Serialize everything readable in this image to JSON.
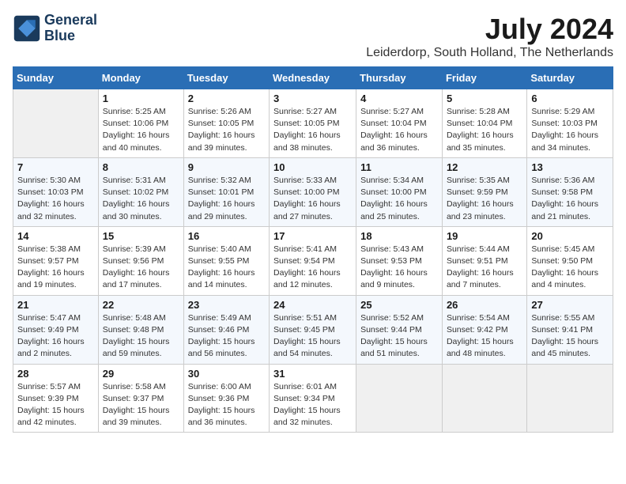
{
  "header": {
    "logo_line1": "General",
    "logo_line2": "Blue",
    "month_year": "July 2024",
    "location": "Leiderdorp, South Holland, The Netherlands"
  },
  "weekdays": [
    "Sunday",
    "Monday",
    "Tuesday",
    "Wednesday",
    "Thursday",
    "Friday",
    "Saturday"
  ],
  "weeks": [
    [
      {
        "day": "",
        "sunrise": "",
        "sunset": "",
        "daylight": ""
      },
      {
        "day": "1",
        "sunrise": "Sunrise: 5:25 AM",
        "sunset": "Sunset: 10:06 PM",
        "daylight": "Daylight: 16 hours and 40 minutes."
      },
      {
        "day": "2",
        "sunrise": "Sunrise: 5:26 AM",
        "sunset": "Sunset: 10:05 PM",
        "daylight": "Daylight: 16 hours and 39 minutes."
      },
      {
        "day": "3",
        "sunrise": "Sunrise: 5:27 AM",
        "sunset": "Sunset: 10:05 PM",
        "daylight": "Daylight: 16 hours and 38 minutes."
      },
      {
        "day": "4",
        "sunrise": "Sunrise: 5:27 AM",
        "sunset": "Sunset: 10:04 PM",
        "daylight": "Daylight: 16 hours and 36 minutes."
      },
      {
        "day": "5",
        "sunrise": "Sunrise: 5:28 AM",
        "sunset": "Sunset: 10:04 PM",
        "daylight": "Daylight: 16 hours and 35 minutes."
      },
      {
        "day": "6",
        "sunrise": "Sunrise: 5:29 AM",
        "sunset": "Sunset: 10:03 PM",
        "daylight": "Daylight: 16 hours and 34 minutes."
      }
    ],
    [
      {
        "day": "7",
        "sunrise": "Sunrise: 5:30 AM",
        "sunset": "Sunset: 10:03 PM",
        "daylight": "Daylight: 16 hours and 32 minutes."
      },
      {
        "day": "8",
        "sunrise": "Sunrise: 5:31 AM",
        "sunset": "Sunset: 10:02 PM",
        "daylight": "Daylight: 16 hours and 30 minutes."
      },
      {
        "day": "9",
        "sunrise": "Sunrise: 5:32 AM",
        "sunset": "Sunset: 10:01 PM",
        "daylight": "Daylight: 16 hours and 29 minutes."
      },
      {
        "day": "10",
        "sunrise": "Sunrise: 5:33 AM",
        "sunset": "Sunset: 10:00 PM",
        "daylight": "Daylight: 16 hours and 27 minutes."
      },
      {
        "day": "11",
        "sunrise": "Sunrise: 5:34 AM",
        "sunset": "Sunset: 10:00 PM",
        "daylight": "Daylight: 16 hours and 25 minutes."
      },
      {
        "day": "12",
        "sunrise": "Sunrise: 5:35 AM",
        "sunset": "Sunset: 9:59 PM",
        "daylight": "Daylight: 16 hours and 23 minutes."
      },
      {
        "day": "13",
        "sunrise": "Sunrise: 5:36 AM",
        "sunset": "Sunset: 9:58 PM",
        "daylight": "Daylight: 16 hours and 21 minutes."
      }
    ],
    [
      {
        "day": "14",
        "sunrise": "Sunrise: 5:38 AM",
        "sunset": "Sunset: 9:57 PM",
        "daylight": "Daylight: 16 hours and 19 minutes."
      },
      {
        "day": "15",
        "sunrise": "Sunrise: 5:39 AM",
        "sunset": "Sunset: 9:56 PM",
        "daylight": "Daylight: 16 hours and 17 minutes."
      },
      {
        "day": "16",
        "sunrise": "Sunrise: 5:40 AM",
        "sunset": "Sunset: 9:55 PM",
        "daylight": "Daylight: 16 hours and 14 minutes."
      },
      {
        "day": "17",
        "sunrise": "Sunrise: 5:41 AM",
        "sunset": "Sunset: 9:54 PM",
        "daylight": "Daylight: 16 hours and 12 minutes."
      },
      {
        "day": "18",
        "sunrise": "Sunrise: 5:43 AM",
        "sunset": "Sunset: 9:53 PM",
        "daylight": "Daylight: 16 hours and 9 minutes."
      },
      {
        "day": "19",
        "sunrise": "Sunrise: 5:44 AM",
        "sunset": "Sunset: 9:51 PM",
        "daylight": "Daylight: 16 hours and 7 minutes."
      },
      {
        "day": "20",
        "sunrise": "Sunrise: 5:45 AM",
        "sunset": "Sunset: 9:50 PM",
        "daylight": "Daylight: 16 hours and 4 minutes."
      }
    ],
    [
      {
        "day": "21",
        "sunrise": "Sunrise: 5:47 AM",
        "sunset": "Sunset: 9:49 PM",
        "daylight": "Daylight: 16 hours and 2 minutes."
      },
      {
        "day": "22",
        "sunrise": "Sunrise: 5:48 AM",
        "sunset": "Sunset: 9:48 PM",
        "daylight": "Daylight: 15 hours and 59 minutes."
      },
      {
        "day": "23",
        "sunrise": "Sunrise: 5:49 AM",
        "sunset": "Sunset: 9:46 PM",
        "daylight": "Daylight: 15 hours and 56 minutes."
      },
      {
        "day": "24",
        "sunrise": "Sunrise: 5:51 AM",
        "sunset": "Sunset: 9:45 PM",
        "daylight": "Daylight: 15 hours and 54 minutes."
      },
      {
        "day": "25",
        "sunrise": "Sunrise: 5:52 AM",
        "sunset": "Sunset: 9:44 PM",
        "daylight": "Daylight: 15 hours and 51 minutes."
      },
      {
        "day": "26",
        "sunrise": "Sunrise: 5:54 AM",
        "sunset": "Sunset: 9:42 PM",
        "daylight": "Daylight: 15 hours and 48 minutes."
      },
      {
        "day": "27",
        "sunrise": "Sunrise: 5:55 AM",
        "sunset": "Sunset: 9:41 PM",
        "daylight": "Daylight: 15 hours and 45 minutes."
      }
    ],
    [
      {
        "day": "28",
        "sunrise": "Sunrise: 5:57 AM",
        "sunset": "Sunset: 9:39 PM",
        "daylight": "Daylight: 15 hours and 42 minutes."
      },
      {
        "day": "29",
        "sunrise": "Sunrise: 5:58 AM",
        "sunset": "Sunset: 9:37 PM",
        "daylight": "Daylight: 15 hours and 39 minutes."
      },
      {
        "day": "30",
        "sunrise": "Sunrise: 6:00 AM",
        "sunset": "Sunset: 9:36 PM",
        "daylight": "Daylight: 15 hours and 36 minutes."
      },
      {
        "day": "31",
        "sunrise": "Sunrise: 6:01 AM",
        "sunset": "Sunset: 9:34 PM",
        "daylight": "Daylight: 15 hours and 32 minutes."
      },
      {
        "day": "",
        "sunrise": "",
        "sunset": "",
        "daylight": ""
      },
      {
        "day": "",
        "sunrise": "",
        "sunset": "",
        "daylight": ""
      },
      {
        "day": "",
        "sunrise": "",
        "sunset": "",
        "daylight": ""
      }
    ]
  ]
}
